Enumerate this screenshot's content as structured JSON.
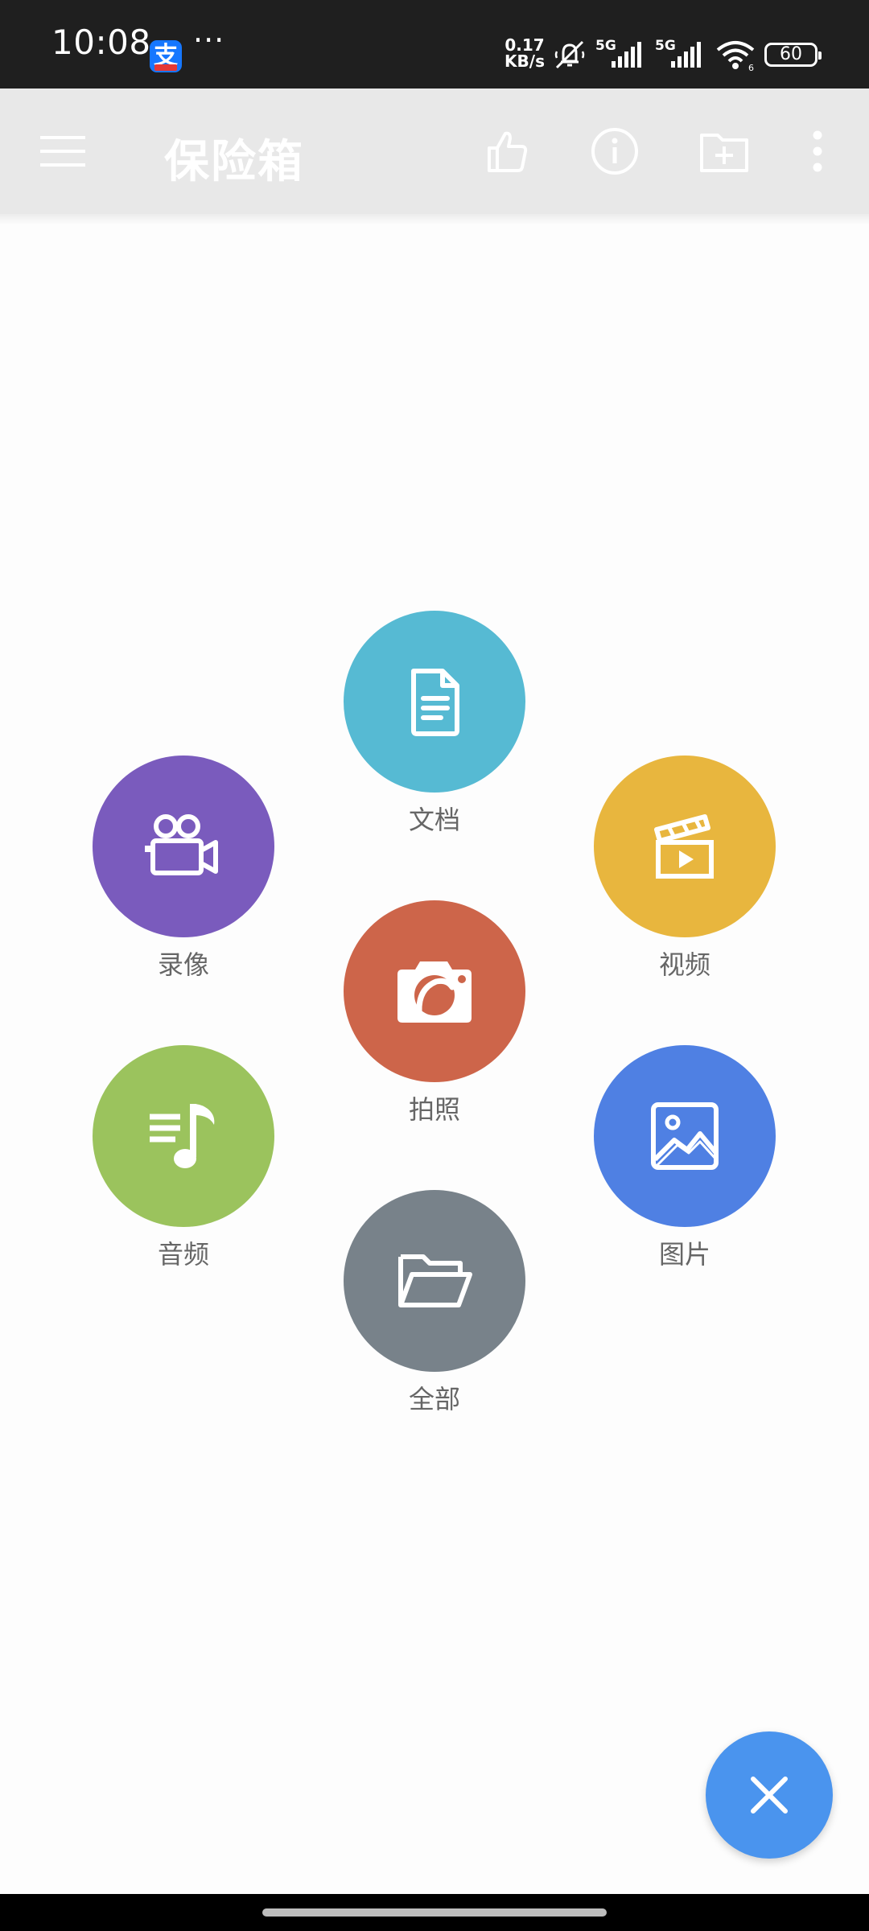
{
  "status_bar": {
    "time": "10:08",
    "app_icon_glyph": "支",
    "more": "···",
    "net_speed_value": "0.17",
    "net_speed_unit": "KB/s",
    "battery": "60",
    "icons": [
      "mute-icon",
      "signal-5g-1-icon",
      "signal-5g-2-icon",
      "wifi-icon",
      "battery-icon"
    ]
  },
  "toolbar": {
    "title": "保险箱",
    "icons": [
      "menu-icon",
      "thumbs-up-icon",
      "info-icon",
      "new-folder-icon",
      "more-vert-icon"
    ],
    "bg_color": "#e8e8e8"
  },
  "categories": [
    {
      "key": "documents",
      "label": "文档",
      "color": "#56bad3",
      "icon": "document-icon"
    },
    {
      "key": "recording",
      "label": "录像",
      "color": "#7a5bbd",
      "icon": "video-camera-icon"
    },
    {
      "key": "video",
      "label": "视频",
      "color": "#e8b63e",
      "icon": "clapperboard-icon"
    },
    {
      "key": "photo",
      "label": "拍照",
      "color": "#cd654a",
      "icon": "camera-icon"
    },
    {
      "key": "audio",
      "label": "音频",
      "color": "#9bc35d",
      "icon": "music-note-icon"
    },
    {
      "key": "pictures",
      "label": "图片",
      "color": "#4f80e3",
      "icon": "image-icon"
    },
    {
      "key": "all",
      "label": "全部",
      "color": "#78828a",
      "icon": "folder-icon"
    }
  ],
  "fab": {
    "icon": "close-icon",
    "color": "#4a94ee"
  }
}
